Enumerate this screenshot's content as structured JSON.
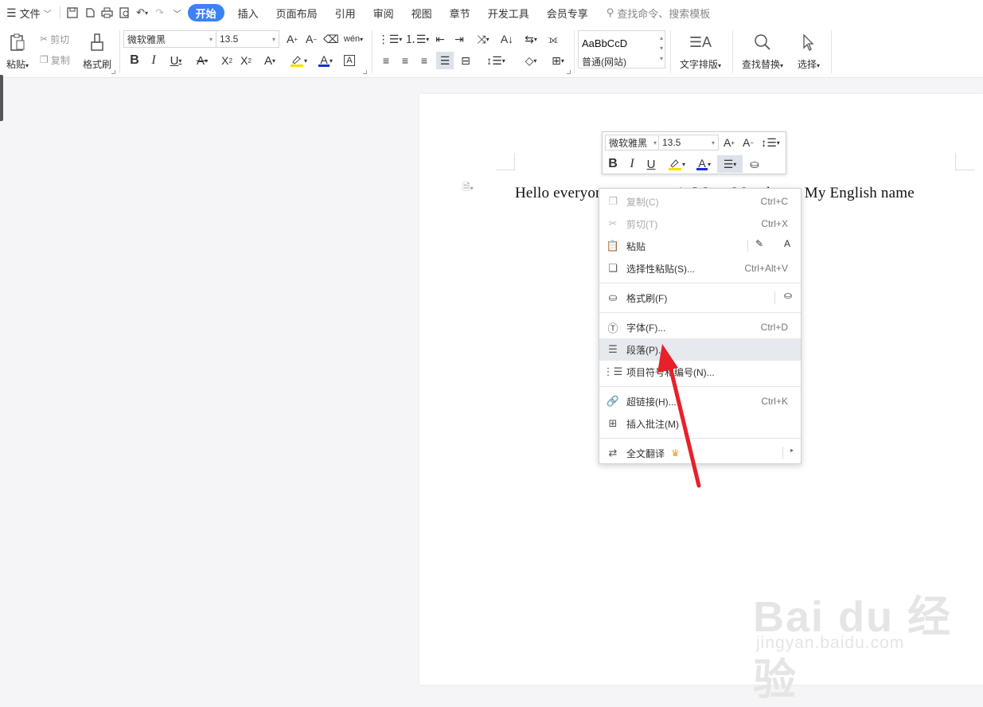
{
  "topbar": {
    "file_label": "文件",
    "tabs": [
      {
        "label": "开始"
      },
      {
        "label": "插入"
      },
      {
        "label": "页面布局"
      },
      {
        "label": "引用"
      },
      {
        "label": "审阅"
      },
      {
        "label": "视图"
      },
      {
        "label": "章节"
      },
      {
        "label": "开发工具"
      },
      {
        "label": "会员专享"
      }
    ],
    "search_placeholder": "查找命令、搜索模板"
  },
  "ribbon": {
    "paste_label": "粘贴",
    "cut_label": "剪切",
    "copy_label": "复制",
    "format_painter_label": "格式刷",
    "font_name": "微软雅黑",
    "font_size": "13.5",
    "style_preview": "AaBbCcD",
    "style_name": "普通(网站)",
    "text_layout_label": "文字排版",
    "find_replace_label": "查找替换",
    "select_label": "选择"
  },
  "document": {
    "body_text": "Hello everyone, my name is Weng Maosheng. My English name"
  },
  "mini_toolbar": {
    "font_name": "微软雅黑",
    "font_size": "13.5"
  },
  "context_menu": {
    "items": [
      {
        "label": "复制(C)",
        "shortcut": "Ctrl+C"
      },
      {
        "label": "剪切(T)",
        "shortcut": "Ctrl+X"
      },
      {
        "label": "粘贴"
      },
      {
        "label": "选择性粘贴(S)...",
        "shortcut": "Ctrl+Alt+V"
      },
      {
        "label": "格式刷(F)"
      },
      {
        "label": "字体(F)...",
        "shortcut": "Ctrl+D"
      },
      {
        "label": "段落(P)..."
      },
      {
        "label": "项目符号和编号(N)..."
      },
      {
        "label": "超链接(H)...",
        "shortcut": "Ctrl+K"
      },
      {
        "label": "插入批注(M)"
      },
      {
        "label": "全文翻译"
      }
    ]
  },
  "watermark": {
    "brand": "Bai du 经验",
    "url": "jingyan.baidu.com"
  },
  "colors": {
    "accent": "#3b82f6",
    "annotation_arrow": "#e8202a",
    "highlight_yellow": "#f5e000",
    "font_color_blue": "#1a2fd0"
  }
}
